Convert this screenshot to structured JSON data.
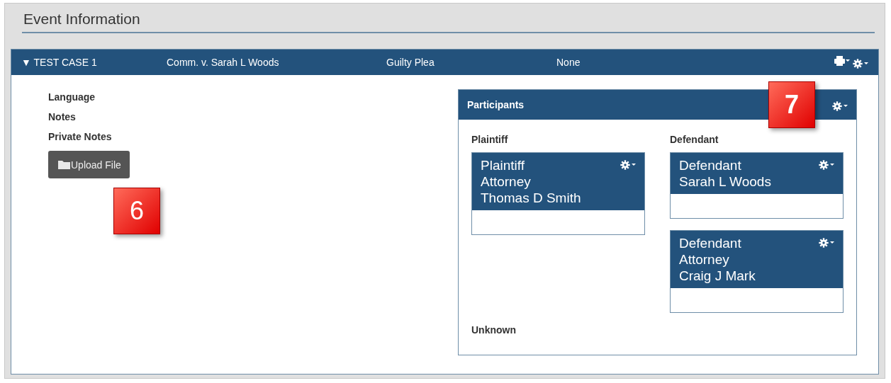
{
  "section_title": "Event Information",
  "case_bar": {
    "toggle": "▼",
    "case_name": "TEST CASE 1",
    "caption": "Comm. v. Sarah L Woods",
    "event_type": "Guilty Plea",
    "status": "None"
  },
  "fields": [
    {
      "label": "Language"
    },
    {
      "label": "Notes"
    },
    {
      "label": "Private Notes"
    }
  ],
  "upload_button": {
    "label": "Upload File",
    "callout": "6"
  },
  "participants": {
    "title": "Participants",
    "callout": "7",
    "groups": [
      {
        "label": "Plaintiff",
        "cards": [
          {
            "lines": [
              "Plaintiff",
              "Attorney",
              "Thomas D Smith"
            ]
          }
        ]
      },
      {
        "label": "Defendant",
        "cards": [
          {
            "lines": [
              "Defendant",
              "Sarah L Woods"
            ]
          },
          {
            "lines": [
              "Defendant",
              "Attorney",
              "Craig J Mark"
            ]
          }
        ]
      },
      {
        "label": "Unknown"
      }
    ]
  }
}
